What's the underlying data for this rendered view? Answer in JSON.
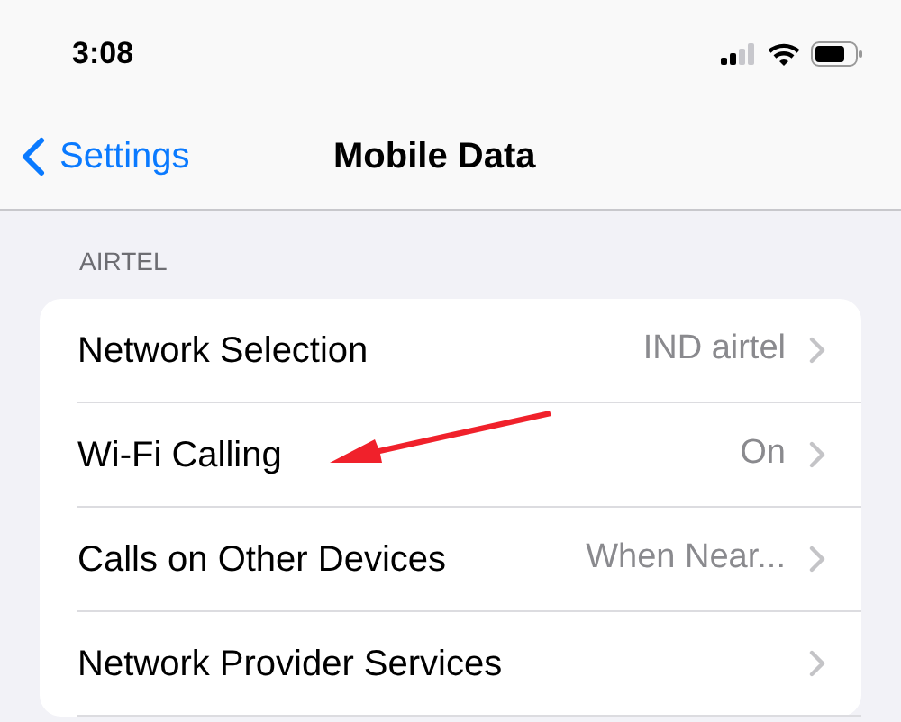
{
  "status_bar": {
    "time": "3:08"
  },
  "nav": {
    "back": "Settings",
    "title": "Mobile Data"
  },
  "section": {
    "header": "AIRTEL",
    "rows": [
      {
        "label": "Network Selection",
        "value": "IND airtel"
      },
      {
        "label": "Wi-Fi Calling",
        "value": "On"
      },
      {
        "label": "Calls on Other Devices",
        "value": "When Near..."
      },
      {
        "label": "Network Provider Services"
      }
    ]
  }
}
